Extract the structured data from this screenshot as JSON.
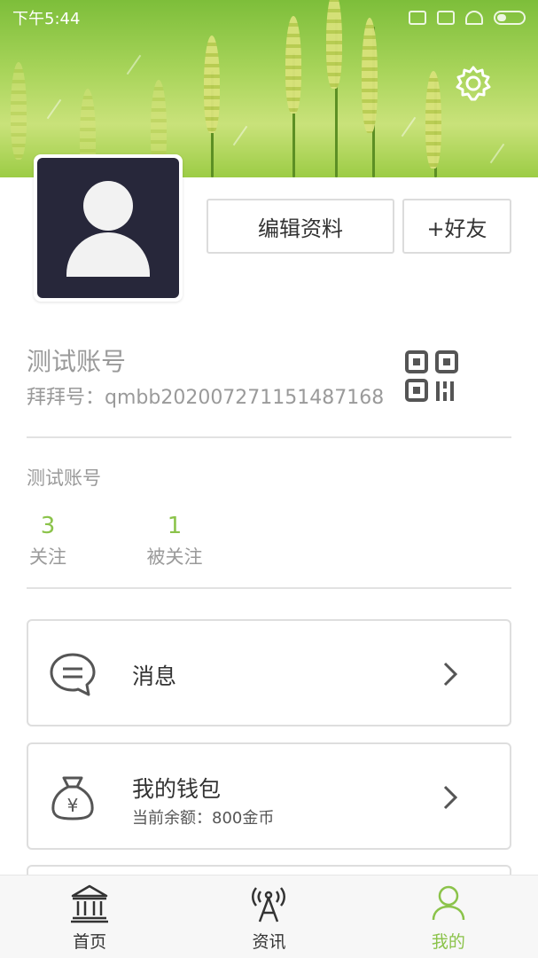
{
  "status_bar": {
    "time": "下午5:44"
  },
  "profile": {
    "name": "测试账号",
    "user_id_label": "拜拜号：qmbb20200727115148716​8",
    "bio": "测试账号",
    "edit_button": "编辑资料",
    "add_friend_button": "+好友"
  },
  "stats": {
    "following_count": "3",
    "following_label": "关注",
    "followers_count": "1",
    "followers_label": "被关注"
  },
  "menu": [
    {
      "title": "消息",
      "icon": "message-icon"
    },
    {
      "title": "我的钱包",
      "subtitle": "当前余额：800金币",
      "icon": "wallet-icon"
    }
  ],
  "bottom_nav": [
    {
      "label": "首页",
      "icon": "bank-icon",
      "active": false
    },
    {
      "label": "资讯",
      "icon": "antenna-icon",
      "active": false
    },
    {
      "label": "我的",
      "icon": "person-icon",
      "active": true
    }
  ],
  "colors": {
    "accent": "#8bc34a",
    "avatar_bg": "#27273a"
  }
}
